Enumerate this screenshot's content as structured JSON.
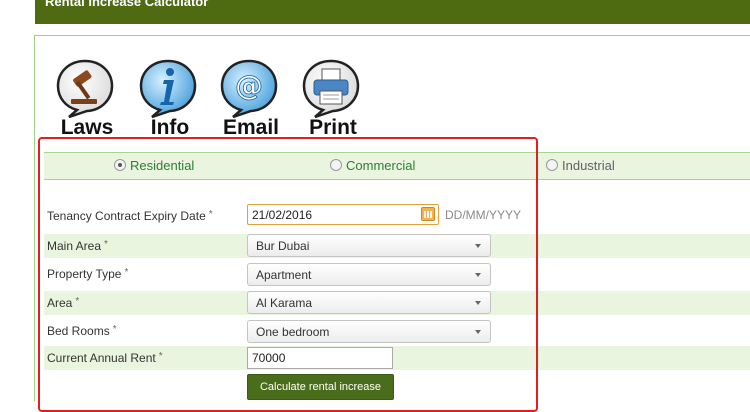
{
  "header": {
    "title": "Rental Increase Calculator"
  },
  "icons": [
    {
      "label": "Laws",
      "icon": "gavel-icon"
    },
    {
      "label": "Info",
      "icon": "info-icon"
    },
    {
      "label": "Email",
      "icon": "at-sign-icon"
    },
    {
      "label": "Print",
      "icon": "printer-icon"
    }
  ],
  "property_types": [
    {
      "label": "Residential",
      "checked": true
    },
    {
      "label": "Commercial",
      "checked": false
    },
    {
      "label": "Industrial",
      "checked": false
    }
  ],
  "form": {
    "expiry": {
      "label": "Tenancy Contract Expiry Date",
      "required": "*",
      "value": "21/02/2016",
      "hint": "DD/MM/YYYY"
    },
    "main_area": {
      "label": "Main Area",
      "required": "*",
      "value": "Bur Dubai"
    },
    "property_type": {
      "label": "Property Type",
      "required": "*",
      "value": "Apartment"
    },
    "area": {
      "label": "Area",
      "required": "*",
      "value": "Al Karama"
    },
    "bedrooms": {
      "label": "Bed Rooms",
      "required": "*",
      "value": "One bedroom"
    },
    "rent": {
      "label": "Current Annual Rent",
      "required": "*",
      "value": "70000"
    },
    "submit_label": "Calculate rental increase"
  },
  "colors": {
    "header_bg": "#4e6b12",
    "row_highlight": "#eaf5e0",
    "accent_green": "#2e7d32",
    "annotation_red": "#e02020"
  }
}
